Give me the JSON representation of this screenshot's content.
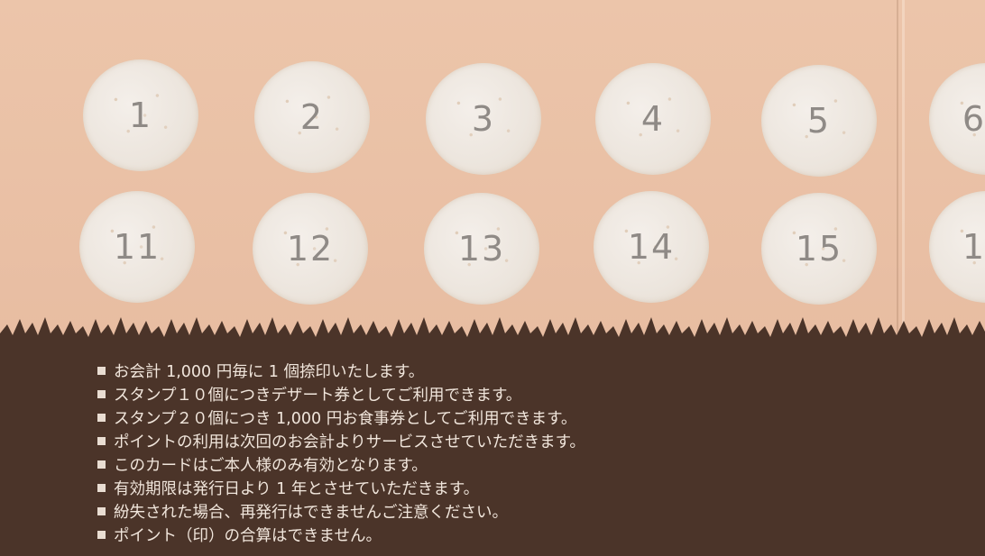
{
  "stamps": {
    "row1": [
      "1",
      "2",
      "3",
      "4",
      "5",
      "6"
    ],
    "row2": [
      "11",
      "12",
      "13",
      "14",
      "15",
      "1"
    ]
  },
  "notes": [
    "お会計 1,000 円毎に 1 個捺印いたします。",
    "スタンプ１０個につきデザート券としてご利用できます。",
    "スタンプ２０個につき 1,000 円お食事券としてご利用できます。",
    "ポイントの利用は次回のお会計よりサービスさせていただきます。",
    "このカードはご本人様のみ有効となります。",
    "有効期限は発行日より 1 年とさせていただきます。",
    "紛失された場合、再発行はできませんご注意ください。",
    "ポイント（印）の合算はできません。"
  ],
  "colors": {
    "card": "#e9bfa4",
    "stamp": "#ece5dd",
    "stamp_number": "#8f8a86",
    "grass_band": "#4b3429",
    "note_text": "#f1e6dc"
  },
  "icons": {
    "bullet": "square-bullet-icon",
    "grass": "grass-edge-decoration"
  }
}
